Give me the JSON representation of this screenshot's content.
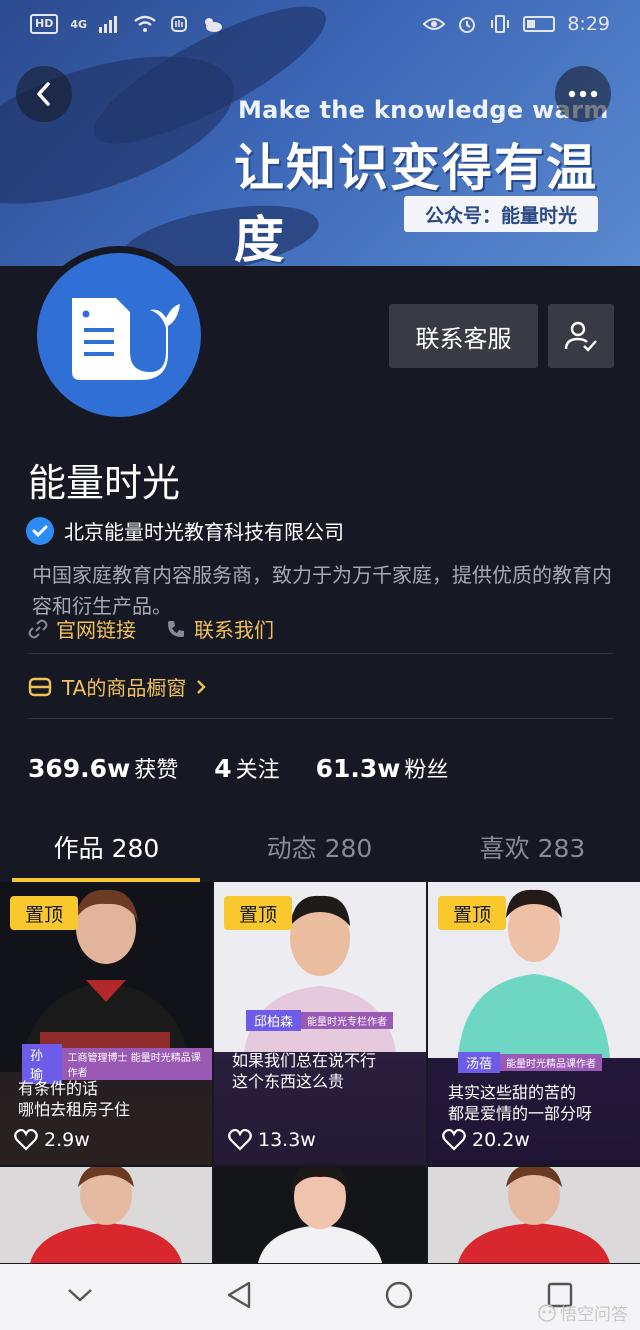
{
  "status_bar": {
    "left_badges": [
      "HD",
      "4G"
    ],
    "time": "8:29"
  },
  "banner": {
    "english": "Make the knowledge warm",
    "chinese": "让知识变得有温度",
    "tag": "公众号：能量时光"
  },
  "header": {
    "back_icon": "chevron-left-icon",
    "more_icon": "more-icon"
  },
  "profile": {
    "contact_label": "联系客服",
    "name": "能量时光",
    "verified_company": "北京能量时光教育科技有限公司",
    "description": "中国家庭教育内容服务商，致力于为万千家庭，提供优质的教育内容和衍生产品。",
    "website_label": "官网链接",
    "contact_us_label": "联系我们",
    "shop_label": "TA的商品橱窗",
    "accent_color": "#f1c15a"
  },
  "stats": [
    {
      "value": "369.6w",
      "label": "获赞"
    },
    {
      "value": "4",
      "label": "关注"
    },
    {
      "value": "61.3w",
      "label": "粉丝"
    }
  ],
  "tabs": [
    {
      "label": "作品 280",
      "active": true
    },
    {
      "label": "动态 280",
      "active": false
    },
    {
      "label": "喜欢 283",
      "active": false
    }
  ],
  "videos": [
    {
      "pinned": "置顶",
      "name": "孙瑜",
      "title": "工商管理博士 能量时光精品课作者",
      "caption_line1": "有条件的话",
      "caption_line2": "哪怕去租房子住",
      "likes": "2.9w"
    },
    {
      "pinned": "置顶",
      "name": "邱柏森",
      "title": "能量时光专栏作者",
      "caption_line1": "如果我们总在说不行",
      "caption_line2": "这个东西这么贵",
      "likes": "13.3w"
    },
    {
      "pinned": "置顶",
      "name": "汤蓓",
      "title": "能量时光精品课作者",
      "caption_line1": "其实这些甜的苦的",
      "caption_line2": "都是爱情的一部分呀",
      "likes": "20.2w"
    }
  ],
  "watermark": "悟空问答"
}
